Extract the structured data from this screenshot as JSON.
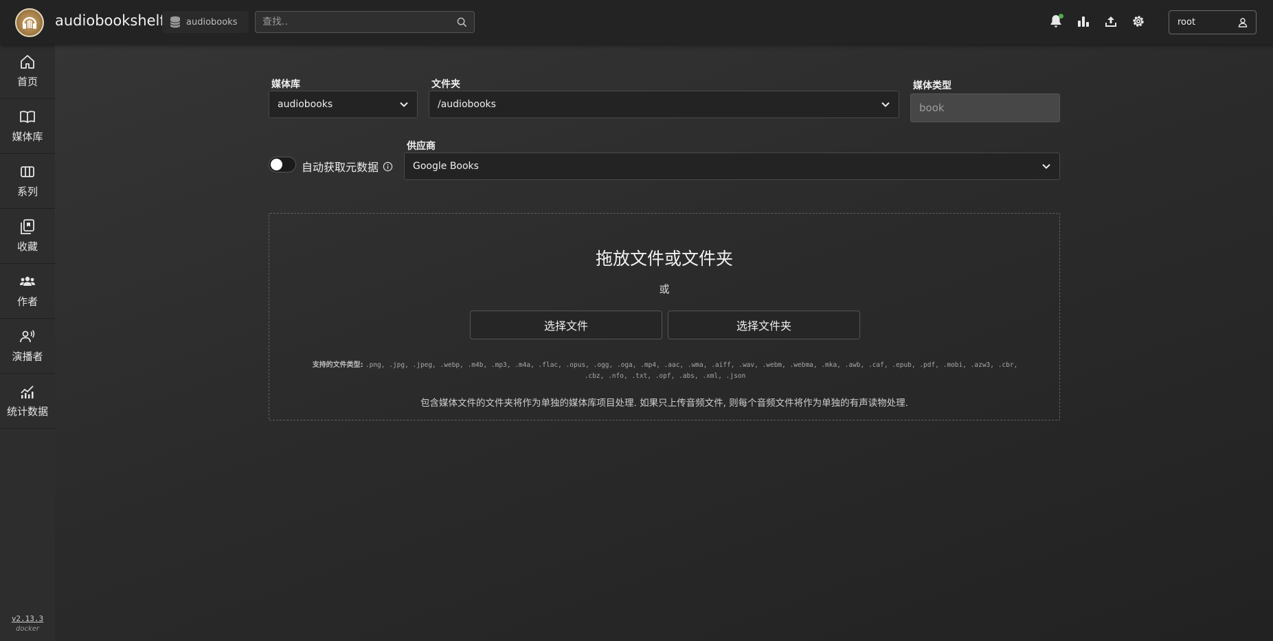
{
  "app": {
    "title": "audiobookshelf"
  },
  "header": {
    "library_selector": "audiobooks",
    "search_placeholder": "查找..",
    "user": "root",
    "icons": [
      "bell-icon",
      "stats-icon",
      "upload-icon",
      "settings-icon",
      "user-icon"
    ]
  },
  "sidebar": {
    "items": [
      {
        "label": "首页",
        "icon": "home-icon"
      },
      {
        "label": "媒体库",
        "icon": "book-icon"
      },
      {
        "label": "系列",
        "icon": "series-icon"
      },
      {
        "label": "收藏",
        "icon": "collection-icon"
      },
      {
        "label": "作者",
        "icon": "authors-icon"
      },
      {
        "label": "演播者",
        "icon": "narrator-icon"
      },
      {
        "label": "统计数据",
        "icon": "stats-icon"
      }
    ],
    "version": "v2.13.3",
    "build": "docker"
  },
  "upload_form": {
    "library_label": "媒体库",
    "library_value": "audiobooks",
    "folder_label": "文件夹",
    "folder_value": "/audiobooks",
    "media_type_label": "媒体类型",
    "media_type_value": "book",
    "auto_fetch_label": "自动获取元数据",
    "auto_fetch_enabled": false,
    "provider_label": "供应商",
    "provider_value": "Google Books"
  },
  "dropzone": {
    "title": "拖放文件或文件夹",
    "or": "或",
    "choose_files": "选择文件",
    "choose_folder": "选择文件夹",
    "supported_label": "支持的文件类型:",
    "supported_types": ".png, .jpg, .jpeg, .webp, .m4b, .mp3, .m4a, .flac, .opus, .ogg, .oga, .mp4, .aac, .wma, .aiff, .wav, .webm, .webma, .mka, .awb, .caf, .epub, .pdf, .mobi, .azw3, .cbr, .cbz, .nfo, .txt, .opf, .abs, .xml, .json",
    "note": "包含媒体文件的文件夹将作为单独的媒体库项目处理. 如果只上传音频文件, 则每个音频文件将作为单独的有声读物处理."
  }
}
